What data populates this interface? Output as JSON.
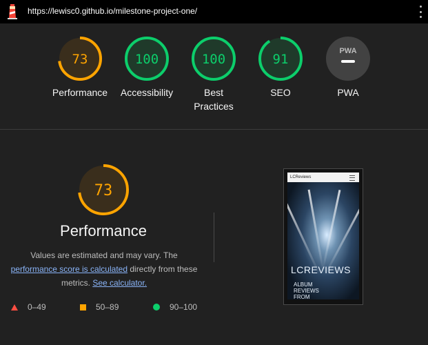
{
  "topbar": {
    "url": "https://lewisc0.github.io/milestone-project-one/"
  },
  "gauges": [
    {
      "label": "Performance",
      "score": "73",
      "value": 73,
      "color": "#ffa400",
      "bg": "#3a2e1c"
    },
    {
      "label": "Accessibility",
      "score": "100",
      "value": 100,
      "color": "#0cce6b",
      "bg": "#1f3a2a"
    },
    {
      "label": "Best Practices",
      "score": "100",
      "value": 100,
      "color": "#0cce6b",
      "bg": "#1f3a2a"
    },
    {
      "label": "SEO",
      "score": "91",
      "value": 91,
      "color": "#0cce6b",
      "bg": "#1f3a2a"
    },
    {
      "label": "PWA",
      "badge": "PWA"
    }
  ],
  "performance": {
    "score": "73",
    "value": 73,
    "title": "Performance",
    "desc_before": "Values are estimated and may vary. The ",
    "desc_link": "performance score is calculated",
    "desc_middle": " directly from these metrics. ",
    "desc_link2": "See calculator.",
    "color": "#ffa400"
  },
  "legend": [
    {
      "range": "0–49",
      "color": "#ff4e42",
      "shape": "triangle"
    },
    {
      "range": "50–89",
      "color": "#ffa400",
      "shape": "square"
    },
    {
      "range": "90–100",
      "color": "#0cce6b",
      "shape": "circle"
    }
  ],
  "screenshot": {
    "brand": "LCReviews",
    "headline": "LCREVIEWS",
    "sub": [
      "ALBUM",
      "REVIEWS",
      "FROM"
    ]
  }
}
